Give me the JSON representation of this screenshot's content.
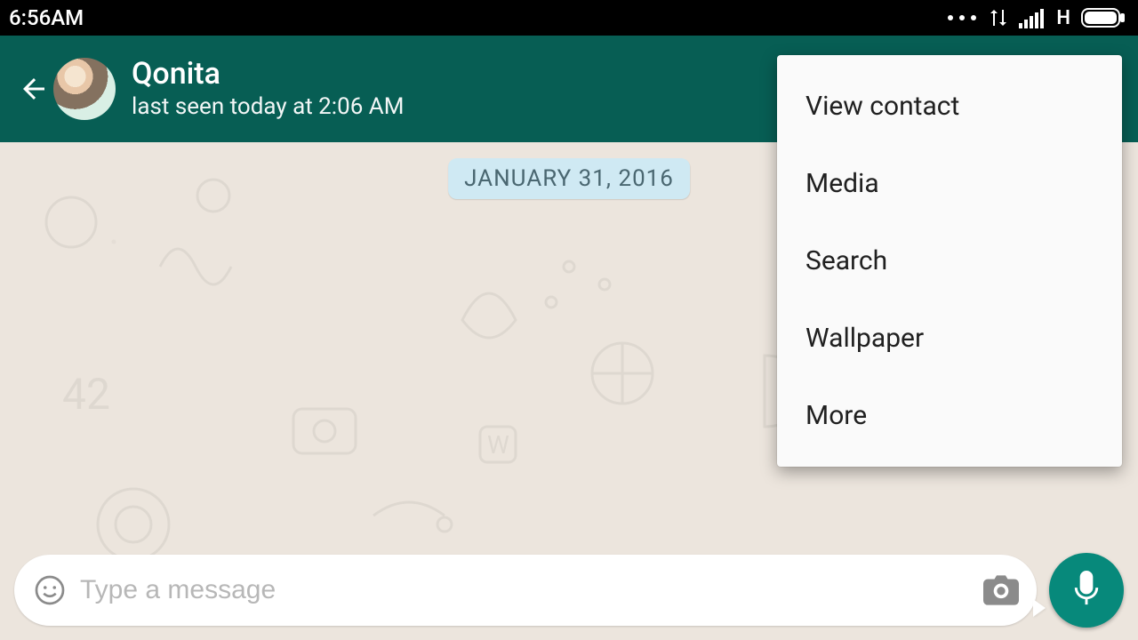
{
  "status": {
    "time": "6:56AM",
    "network_type": "H"
  },
  "header": {
    "contact_name": "Qonita",
    "last_seen": "last seen today at 2:06 AM"
  },
  "chat": {
    "date_label": "JANUARY 31, 2016"
  },
  "menu": {
    "items": [
      {
        "label": "View contact"
      },
      {
        "label": "Media"
      },
      {
        "label": "Search"
      },
      {
        "label": "Wallpaper"
      },
      {
        "label": "More"
      }
    ]
  },
  "input": {
    "placeholder": "Type a message"
  },
  "colors": {
    "header_bg": "#075e54",
    "fab_bg": "#07897b",
    "chat_bg": "#ece5dd",
    "date_chip_bg": "#cfe9f3"
  }
}
